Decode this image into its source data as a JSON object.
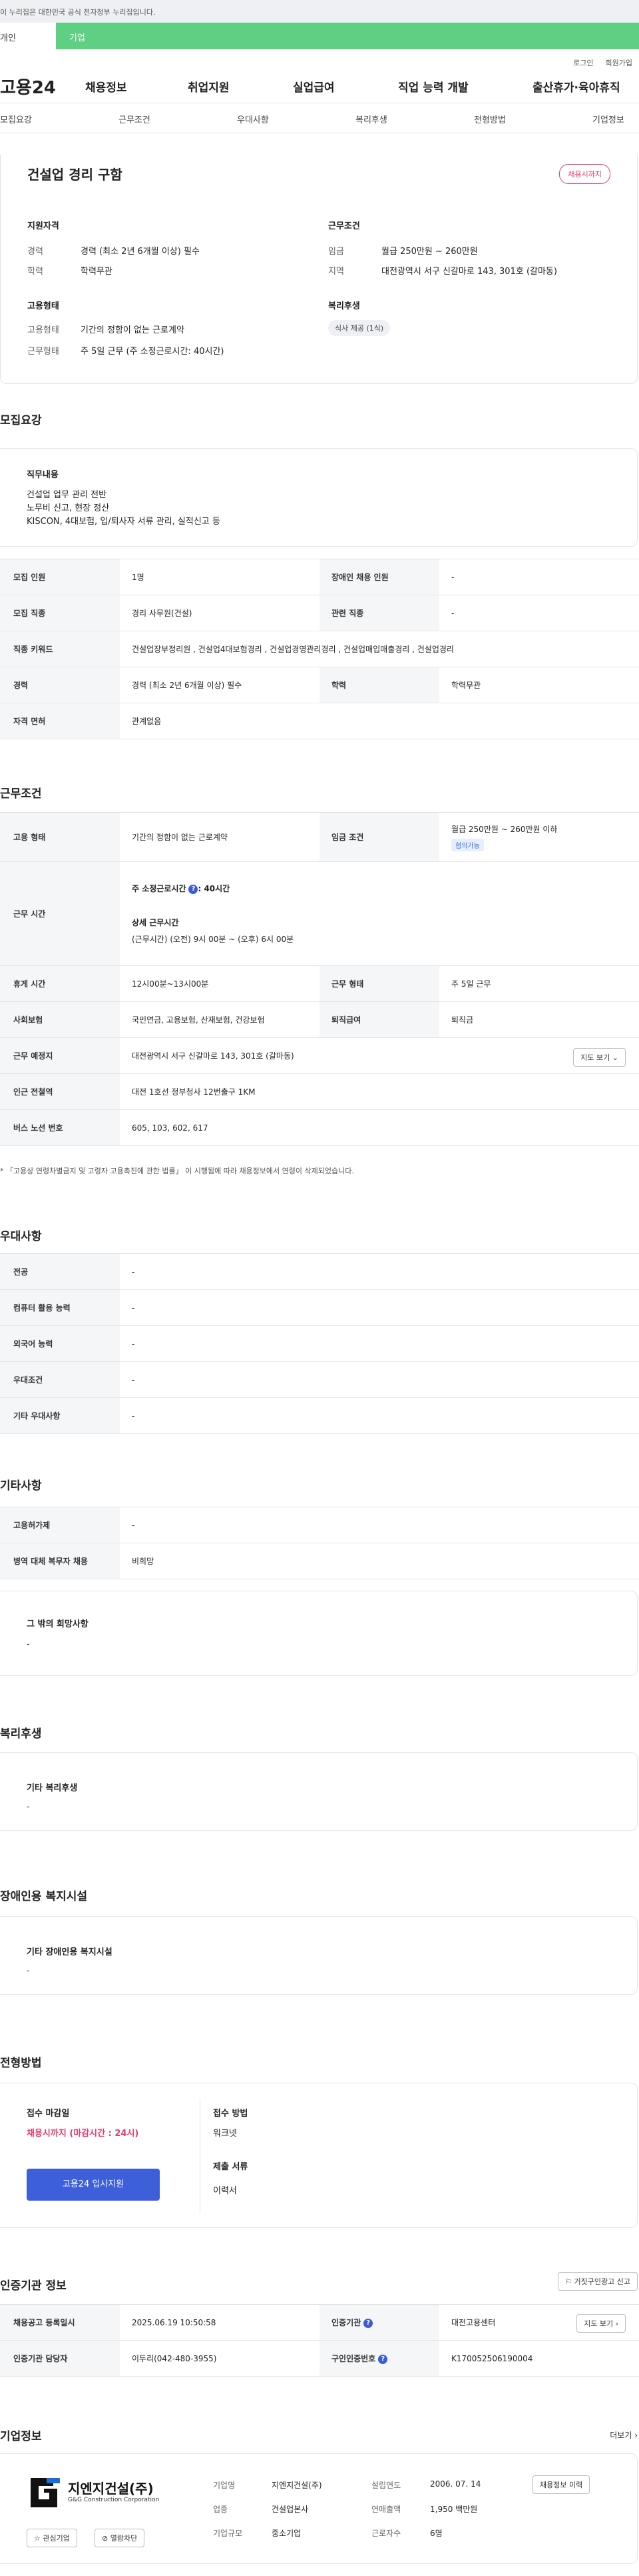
{
  "gov_banner": {
    "text": "이 누리집은 대한민국 공식 전자정부 누리집입니다."
  },
  "gov_tabs": {
    "personal": "개인",
    "enterprise": "기업"
  },
  "util": {
    "login": "로그인",
    "signup": "회원가입"
  },
  "gnb": {
    "logo": "고용24",
    "items": [
      "채용정보",
      "취업지원",
      "실업급여",
      "직업 능력 개발",
      "출산휴가·육아휴직"
    ]
  },
  "lnb": {
    "items": [
      "모집요강",
      "근무조건",
      "우대사항",
      "복리후생",
      "전형방법",
      "기업정보"
    ]
  },
  "summary": {
    "title": "건설업 경리 구함",
    "status_badge": "채용시까지",
    "left_groups": [
      {
        "heading": "지원자격",
        "rows": [
          {
            "label": "경력",
            "value": "경력 (최소 2년 6개월 이상) 필수"
          },
          {
            "label": "학력",
            "value": "학력무관"
          }
        ]
      },
      {
        "heading": "고용형태",
        "rows": [
          {
            "label": "고용형태",
            "value": "기간의 정함이 없는 근로계약"
          },
          {
            "label": "근무형태",
            "value": "주 5일 근무 (주 소정근로시간: 40시간)"
          }
        ]
      }
    ],
    "right_groups": {
      "work_heading": "근무조건",
      "wage_label": "임금",
      "wage_value": "월급 250만원 ~ 260만원",
      "region_label": "지역",
      "region_value": "대전광역시 서구 신갈마로 143, 301호 (갈마동)",
      "welfare_heading": "복리후생",
      "welfare_pill": "식사 제공 (1식)"
    }
  },
  "recruit": {
    "section_title": "모집요강",
    "duty_heading": "직무내용",
    "duty_lines": [
      "건설업 업무 관리 전반",
      "노무비 신고, 현장 정산",
      "KISCON, 4대보험, 입/퇴사자 서류 관리, 실적신고 등"
    ],
    "table": {
      "headcount_label": "모집 인원",
      "headcount": "1명",
      "disabled_label": "장애인 채용 인원",
      "disabled": "-",
      "job_label": "모집 직종",
      "job": "경리 사무원(건설)",
      "related_label": "관련 직종",
      "related": "-",
      "keyword_label": "직종 키워드",
      "keyword": "건설업장부정리원 , 건설업4대보험경리 , 건설업경영관리경리 , 건설업매입매출경리 , 건설업경리",
      "career_label": "경력",
      "career": "경력 (최소 2년 6개월 이상) 필수",
      "edu_label": "학력",
      "edu": "학력무관",
      "license_label": "자격 면허",
      "license": "관계없음"
    }
  },
  "work": {
    "section_title": "근무조건",
    "employ_label": "고용 형태",
    "employ": "기간의 정함이 없는 근로계약",
    "wage_label": "임금 조건",
    "wage": "월급 250만원 ~ 260만원 이하",
    "wage_tag": "협의가능",
    "hours_label": "근무 시간",
    "hours_weekly": "주 소정근로시간",
    "hours_weekly_value": ": 40시간",
    "hours_detail_heading": "상세 근무시간",
    "hours_detail": "(근무시간) (오전) 9시 00분 ~ (오후) 6시 00분",
    "break_label": "휴게 시간",
    "break": "12시00분~13시00분",
    "worktype_label": "근무 형태",
    "worktype": "주 5일 근무",
    "insurance_label": "사회보험",
    "insurance": "국민연금, 고용보험, 산재보험, 건강보험",
    "severance_label": "퇴직급여",
    "severance": "퇴직금",
    "location_label": "근무 예정지",
    "location": "대전광역시 서구 신갈마로 143, 301호 (갈마동)",
    "map_btn": "지도 보기",
    "subway_label": "인근 전철역",
    "subway": "대전 1호선 정부청사 12번출구 1KM",
    "bus_label": "버스 노선 번호",
    "bus": "605, 103, 602, 617",
    "footnote": "* 「고용상 연령차별금지 및 고령자 고용촉진에 관한 법률」 이 시행됨에 따라 채용정보에서 연령이 삭제되었습니다."
  },
  "preference": {
    "section_title": "우대사항",
    "rows": [
      {
        "label": "전공",
        "value": "-"
      },
      {
        "label": "컴퓨터 활용 능력",
        "value": "-"
      },
      {
        "label": "외국어 능력",
        "value": "-"
      },
      {
        "label": "우대조건",
        "value": "-"
      },
      {
        "label": "기타 우대사항",
        "value": "-"
      }
    ]
  },
  "etc": {
    "section_title": "기타사항",
    "rows": [
      {
        "label": "고용허가제",
        "value": "-"
      },
      {
        "label": "병역 대체 복무자 채용",
        "value": "비희망"
      }
    ],
    "other_heading": "그 밖의 희망사항",
    "other_value": "-"
  },
  "welfare": {
    "section_title": "복리후생",
    "heading": "기타 복리후생",
    "value": "-"
  },
  "disability": {
    "section_title": "장애인용 복지시설",
    "heading": "기타 장애인용 복지시설",
    "value": "-"
  },
  "process": {
    "section_title": "전형방법",
    "deadline_heading": "접수 마감일",
    "deadline": "채용시까지 (마감시간 : 24시)",
    "method_heading": "접수 방법",
    "method": "워크넷",
    "docs_heading": "제출 서류",
    "docs": "이력서",
    "apply_btn": "고용24 입사지원"
  },
  "cert": {
    "section_title": "인증기관 정보",
    "report_btn": "거짓구인광고 신고",
    "reg_label": "채용공고 등록일시",
    "reg": "2025.06.19 10:50:58",
    "org_label": "인증기관",
    "org": "대전고용센터",
    "map_btn": "지도 보기",
    "manager_label": "인증기관 담당자",
    "manager": "이두리(042-480-3955)",
    "reqno_label": "구인인증번호",
    "reqno": "K170052506190004"
  },
  "company": {
    "section_title": "기업정보",
    "more": "더보기",
    "logo_text": "지엔지건설(주)",
    "logo_sub": "G&G Construction Corporation",
    "fav_btn": "관심기업",
    "block_btn": "열람차단",
    "name_label": "기업명",
    "name": "지엔지건설(주)",
    "industry_label": "업종",
    "industry": "건설업본사",
    "size_label": "기업규모",
    "size": "중소기업",
    "founded_label": "설립연도",
    "founded": "2006. 07. 14",
    "revenue_label": "연매출액",
    "revenue": "1,950 백만원",
    "employees_label": "근로자수",
    "employees": "6명",
    "history_btn": "채용정보 이력"
  }
}
